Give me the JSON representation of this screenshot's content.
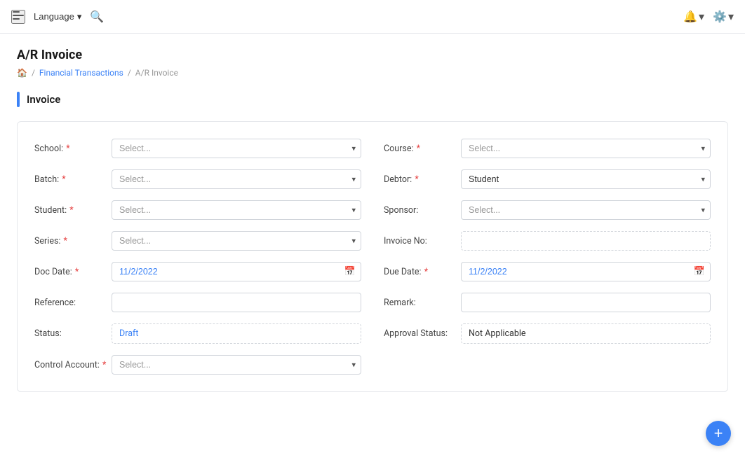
{
  "topbar": {
    "language_label": "Language",
    "chevron_down": "▾",
    "notification_label": "Notifications",
    "settings_label": "Settings"
  },
  "breadcrumb": {
    "home_label": "🏠",
    "separator1": "/",
    "section_label": "Financial Transactions",
    "separator2": "/",
    "current_label": "A/R Invoice"
  },
  "page": {
    "title": "A/R Invoice",
    "section_title": "Invoice"
  },
  "form": {
    "school_label": "School:",
    "school_placeholder": "Select...",
    "course_label": "Course:",
    "course_placeholder": "Select...",
    "batch_label": "Batch:",
    "batch_placeholder": "Select...",
    "debtor_label": "Debtor:",
    "debtor_value": "Student",
    "student_label": "Student:",
    "student_placeholder": "Select...",
    "sponsor_label": "Sponsor:",
    "sponsor_placeholder": "Select...",
    "series_label": "Series:",
    "series_placeholder": "Select...",
    "invoice_no_label": "Invoice No:",
    "invoice_no_value": "",
    "doc_date_label": "Doc Date:",
    "doc_date_value": "11/2/2022",
    "due_date_label": "Due Date:",
    "due_date_value": "11/2/2022",
    "reference_label": "Reference:",
    "reference_value": "",
    "remark_label": "Remark:",
    "remark_value": "",
    "status_label": "Status:",
    "status_value": "Draft",
    "approval_status_label": "Approval Status:",
    "approval_status_value": "Not Applicable",
    "control_account_label": "Control Account:",
    "control_account_placeholder": "Select...",
    "fab_label": "+"
  }
}
